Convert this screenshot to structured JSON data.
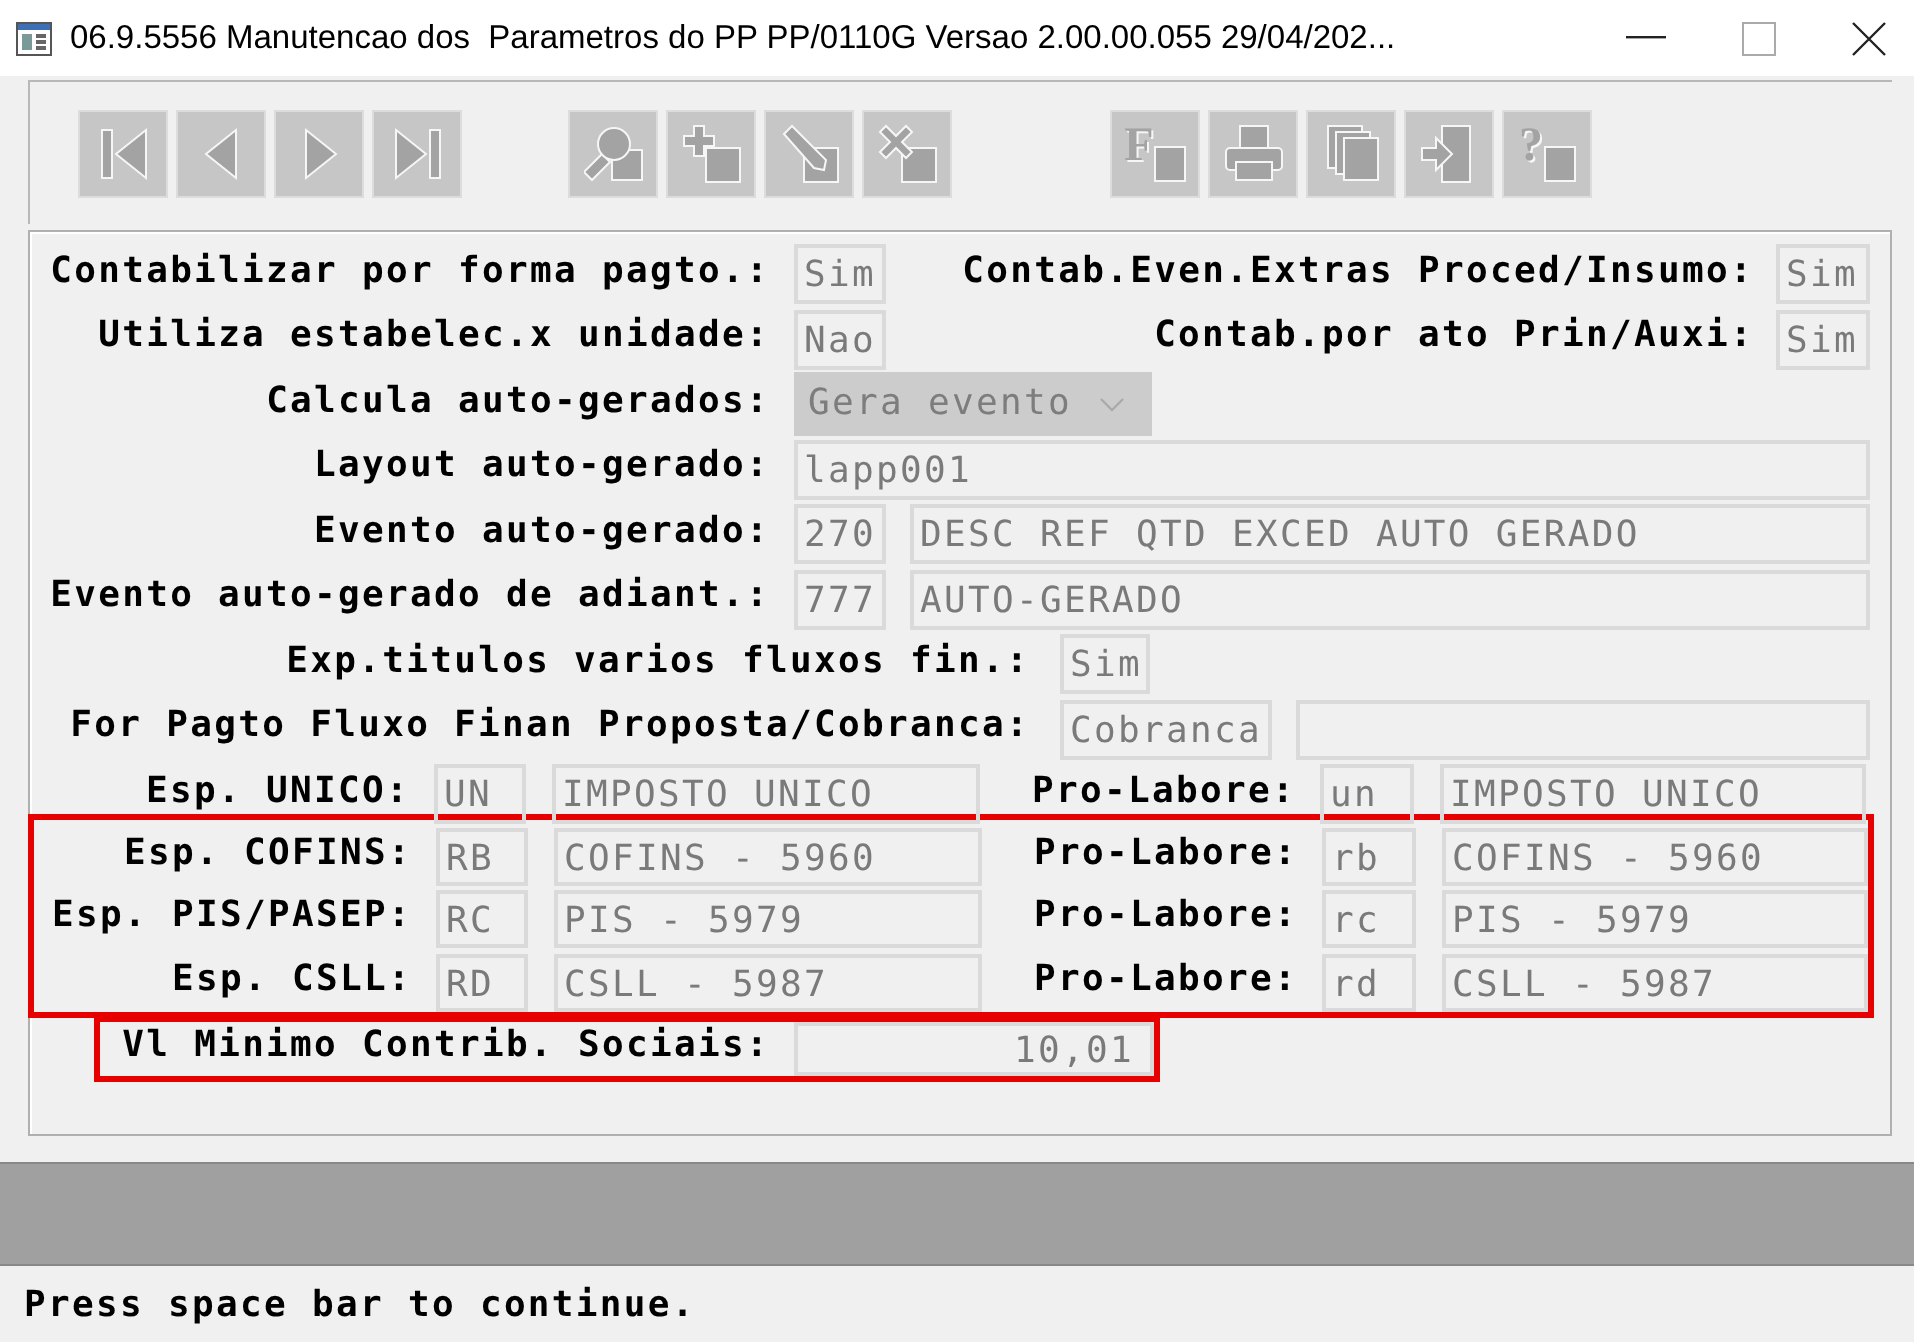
{
  "window": {
    "title": "06.9.5556 Manutencao dos  Parametros do PP PP/0110G Versao 2.00.00.055 29/04/202..."
  },
  "toolbar": {
    "groups": [
      [
        {
          "kind": "first"
        },
        {
          "kind": "previous"
        },
        {
          "kind": "next"
        },
        {
          "kind": "last"
        }
      ],
      [
        {
          "kind": "search"
        },
        {
          "kind": "add"
        },
        {
          "kind": "edit"
        },
        {
          "kind": "delete"
        }
      ],
      [
        {
          "kind": "filter",
          "glyph": "F"
        },
        {
          "kind": "print"
        },
        {
          "kind": "copy"
        },
        {
          "kind": "exit"
        },
        {
          "kind": "help",
          "glyph": "?"
        }
      ]
    ]
  },
  "form": {
    "sections": [
      {
        "highlighted": false,
        "rows": [
          {
            "kind": "pair",
            "label": "Contabilizar por forma pagto.:",
            "value": "Sim",
            "label_2": "Contab.Even.Extras Proced/Insumo:",
            "value_2": "Sim"
          },
          {
            "kind": "pair",
            "label": "Utiliza estabelec.x unidade:",
            "value": "Nao",
            "label_2": "Contab.por ato Prin/Auxi:",
            "value_2": "Sim"
          },
          {
            "kind": "select",
            "label": "Calcula auto-gerados:",
            "value": "Gera evento",
            "disabled": true
          },
          {
            "kind": "text",
            "label": "Layout auto-gerado:",
            "value": "lapp001"
          },
          {
            "kind": "event",
            "label": "Evento auto-gerado:",
            "code": "270",
            "description": "DESC REF QTD EXCED AUTO GERADO"
          },
          {
            "kind": "event",
            "label": "Evento auto-gerado de adiant.:",
            "code": "777",
            "description": "AUTO-GERADO"
          },
          {
            "kind": "option",
            "label": "Exp.titulos varios fluxos fin.:",
            "value": "Sim"
          },
          {
            "kind": "option_extra",
            "label": "For Pagto Fluxo Finan Proposta/Cobranca:",
            "value": "Cobranca"
          },
          {
            "kind": "species",
            "label": "Esp. UNICO:",
            "code": "UN",
            "description": "IMPOSTO UNICO",
            "label_2": "Pro-Labore:",
            "code_2": "un",
            "description_2": "IMPOSTO UNICO"
          }
        ]
      },
      {
        "highlighted": true,
        "rows": [
          {
            "kind": "species",
            "label": "Esp. COFINS:",
            "code": "RB",
            "description": "COFINS - 5960",
            "label_2": "Pro-Labore:",
            "code_2": "rb",
            "description_2": "COFINS - 5960"
          },
          {
            "kind": "species",
            "label": "Esp. PIS/PASEP:",
            "code": "RC",
            "description": "PIS - 5979",
            "label_2": "Pro-Labore:",
            "code_2": "rc",
            "description_2": "PIS - 5979"
          },
          {
            "kind": "species",
            "label": "Esp. CSLL:",
            "code": "RD",
            "description": "CSLL - 5987",
            "label_2": "Pro-Labore:",
            "code_2": "rd",
            "description_2": "CSLL - 5987"
          }
        ]
      },
      {
        "highlighted": true,
        "rows": [
          {
            "kind": "amount",
            "label": "Vl Minimo Contrib. Sociais:",
            "value": "10,01"
          }
        ]
      }
    ]
  },
  "status_bar": {
    "message": "Press space bar to continue."
  }
}
